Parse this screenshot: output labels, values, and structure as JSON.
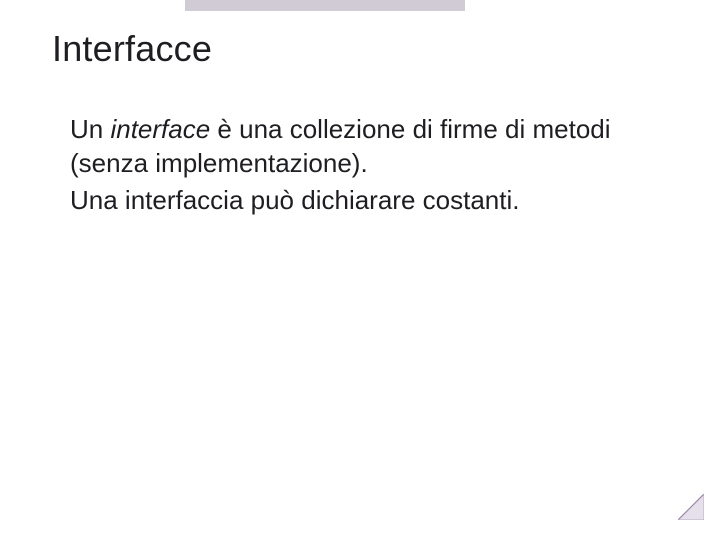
{
  "slide": {
    "title": "Interfacce",
    "p1_a": "Un ",
    "p1_em": "interface",
    "p1_b": " è una collezione di firme di metodi (senza implementazione).",
    "p2": "Una interfaccia può dichiarare costanti."
  }
}
